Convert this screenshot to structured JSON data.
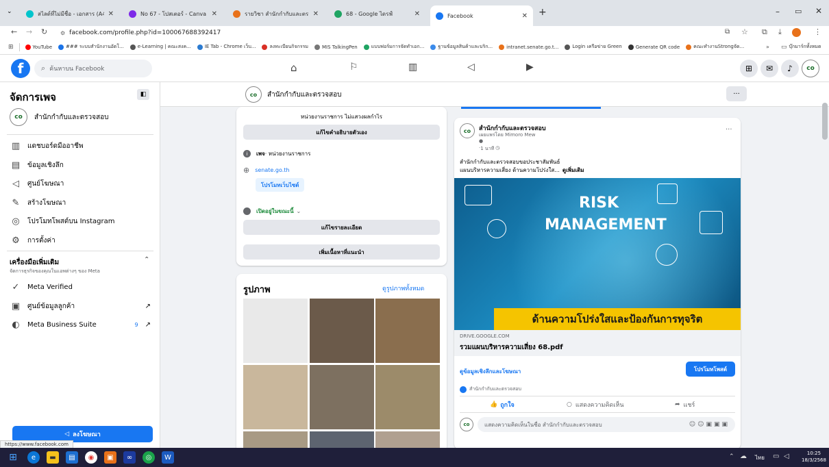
{
  "browser": {
    "tabs": [
      {
        "label": "สไลด์ที่ไม่มีชื่อ - เอกสาร (A4) - Can",
        "color": "#00c4cc"
      },
      {
        "label": "No 67 - โปสเตอร์ - Canva",
        "color": "#7d2ae8"
      },
      {
        "label": "รายวิชา สำนักกำกับและตรวจสอบ 2",
        "color": "#e8711a"
      },
      {
        "label": "68 - Google ไดรฟ์",
        "color": "#1fa463"
      },
      {
        "label": "Facebook",
        "color": "#1877f2"
      }
    ],
    "url": "facebook.com/profile.php?id=100067688392417",
    "bookmarks": [
      {
        "label": "YouTube",
        "color": "#ff0000"
      },
      {
        "label": "### ระบบสำนักงานอัตโ...",
        "color": "#1a73e8"
      },
      {
        "label": "e-Learning | คณะสงค...",
        "color": "#555555"
      },
      {
        "label": "IE Tab - Chrome เว็บ...",
        "color": "#2b7bd1"
      },
      {
        "label": "ลงทะเบียนกิจกรรม",
        "color": "#d93025"
      },
      {
        "label": "MIS TalkingPen",
        "color": "#777777"
      },
      {
        "label": "แบบฟอร์มการจัดทำเอก...",
        "color": "#1fa463"
      },
      {
        "label": "ฐานข้อมูลสินค้าและบริก...",
        "color": "#3b8beb"
      },
      {
        "label": "intranet.senate.go.t...",
        "color": "#e8711a"
      },
      {
        "label": "Login เครือข่าย Green",
        "color": "#555555"
      },
      {
        "label": "Generate QR code",
        "color": "#333333"
      },
      {
        "label": "คณะทำงานStrongจัด...",
        "color": "#e8711a"
      }
    ],
    "bookmarks_other": "บุ๊กมาร์กทั้งหมด",
    "status_url": "https://www.facebook.com"
  },
  "fb": {
    "search_placeholder": "ค้นหาบน Facebook",
    "page_name": "สำนักกำกับและตรวจสอบ"
  },
  "sidebar": {
    "title": "จัดการเพจ",
    "page_name": "สำนักกำกับและตรวจสอบ",
    "items": [
      {
        "label": "แดชบอร์ดมืออาชีพ",
        "icon": "dashboard-icon",
        "glyph": "▥"
      },
      {
        "label": "ข้อมูลเชิงลึก",
        "icon": "insights-icon",
        "glyph": "▤"
      },
      {
        "label": "ศูนย์โฆษณา",
        "icon": "megaphone-icon",
        "glyph": "◁"
      },
      {
        "label": "สร้างโฆษณา",
        "icon": "pencil-icon",
        "glyph": "✎"
      },
      {
        "label": "โปรโมทโพสต์บน Instagram",
        "icon": "instagram-icon",
        "glyph": "◎"
      },
      {
        "label": "การตั้งค่า",
        "icon": "gear-icon",
        "glyph": "⚙"
      }
    ],
    "tools_title": "เครื่องมือเพิ่มเติม",
    "tools_subtitle": "จัดการธุรกิจของคุณในแอพต่างๆ ของ Meta",
    "tools": [
      {
        "label": "Meta Verified",
        "icon": "verified-icon",
        "glyph": "✓",
        "arrow": ""
      },
      {
        "label": "ศูนย์ข้อมูลลูกค้า",
        "icon": "contacts-icon",
        "glyph": "▣",
        "arrow": "↗"
      },
      {
        "label": "Meta Business Suite",
        "icon": "business-suite-icon",
        "glyph": "◐",
        "arrow": "↗",
        "badge": "9"
      }
    ],
    "advertise_label": "ลงโฆษณา"
  },
  "intro": {
    "category_line": "หน่วยงานราชการ ไม่แสวงผลกำไร",
    "edit_bio": "แก้ไขคำอธิบายตัวเอง",
    "page_type_bold": "เพจ",
    "page_type_rest": " · หน่วยงานราชการ",
    "website": "senate.go.th",
    "promote_website": "โปรโมทเว็บไซต์",
    "open_now": "เปิดอยู่ในขณะนี้",
    "edit_details": "แก้ไขรายละเอียด",
    "add_featured": "เพิ่มเนื้อหาที่แนะนำ"
  },
  "photos": {
    "title": "รูปภาพ",
    "see_all": "ดูรูปภาพทั้งหมด"
  },
  "post": {
    "author": "สำนักกำกับและตรวจสอบ",
    "published_by": "เผยแพร่โดย Mimoro Mew",
    "time": "1 นาที",
    "text_line1": "สำนักกำกับและตรวจสอบขอประชาสัมพันธ์",
    "text_line2": "แผนบริหารความเสี่ยง ด้านความโปร่งใส...",
    "see_more": "ดูเพิ่มเติม",
    "image_title1": "RISK",
    "image_title2": "MANAGEMENT",
    "image_banner": "ด้านความโปร่งใสและป้องกันการทุจริต",
    "link_domain": "DRIVE.GOOGLE.COM",
    "link_title": "รวมแผนบริหารความเสี่ยง 68.pdf",
    "insights_link": "ดูข้อมูลเชิงลึกและโฆษณา",
    "boost_label": "โปรโมทโพสต์",
    "reaction_name": "สำนักกำกับและตรวจสอบ",
    "like": "ถูกใจ",
    "comment": "แสดงความคิดเห็น",
    "share": "แชร์",
    "comment_placeholder": "แสดงความคิดเห็นในชื่อ สำนักกำกับและตรวจสอบ"
  },
  "taskbar": {
    "lang": "ไทย",
    "time": "10:25",
    "date": "18/3/2568"
  },
  "colors": {
    "fb_blue": "#1877f2",
    "banner_yellow": "#f5c400"
  }
}
